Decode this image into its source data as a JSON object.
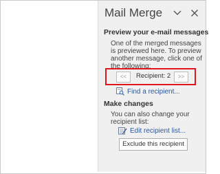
{
  "pane": {
    "title": "Mail Merge",
    "chevron_icon": "chevron-down-icon",
    "close_icon": "close-icon"
  },
  "preview_section": {
    "heading": "Preview your e-mail messages",
    "description_lines": [
      "One of the merged messages",
      "is previewed here. To preview",
      "another message, click one of",
      "the following:"
    ],
    "prev_button": "<<",
    "next_button": ">>",
    "recipient_label": "Recipient: 2",
    "find_icon": "find-recipient-icon",
    "find_link": "Find a recipient..."
  },
  "changes_section": {
    "heading": "Make changes",
    "description_lines": [
      "You can also change your",
      "recipient list:"
    ],
    "edit_icon": "edit-list-icon",
    "edit_link": "Edit recipient list...",
    "exclude_button": "Exclude this recipient"
  },
  "colors": {
    "pane_background": "#f0f0f0",
    "highlight_border": "#e0151c",
    "link": "#2b579a"
  }
}
